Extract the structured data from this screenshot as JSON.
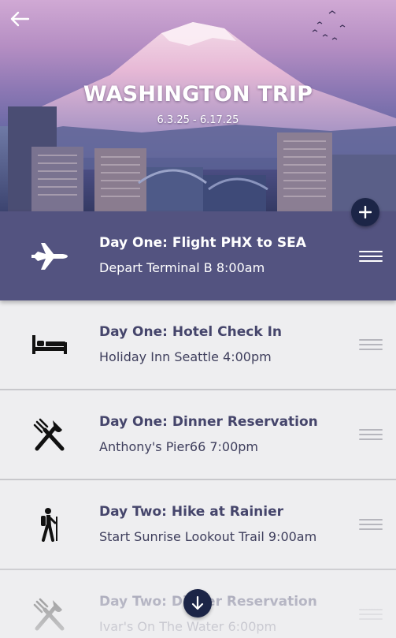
{
  "header": {
    "title": "WASHINGTON TRIP",
    "dates": "6.3.25 - 6.17.25"
  },
  "icons": {
    "back": "back-arrow-icon",
    "add": "plus-icon",
    "scroll": "arrow-down-icon"
  },
  "colors": {
    "active_row": "#535380",
    "button": "#1c2547",
    "title_text": "#45456b"
  },
  "itinerary": [
    {
      "title": "Day One: Flight PHX to SEA",
      "detail": "Depart Terminal B 8:00am",
      "icon": "airplane-icon",
      "active": true
    },
    {
      "title": "Day One: Hotel Check In",
      "detail": "Holiday Inn Seattle 4:00pm",
      "icon": "bed-icon",
      "active": false
    },
    {
      "title": "Day One: Dinner Reservation",
      "detail": "Anthony's Pier66 7:00pm",
      "icon": "fork-knife-icon",
      "active": false
    },
    {
      "title": "Day Two: Hike at Rainier",
      "detail": "Start Sunrise Lookout Trail 9:00am",
      "icon": "hiker-icon",
      "active": false
    },
    {
      "title": "Day Two: Dinner Reservation",
      "detail": "Ivar's On The Water 6:00pm",
      "icon": "fork-knife-icon",
      "active": false
    }
  ]
}
